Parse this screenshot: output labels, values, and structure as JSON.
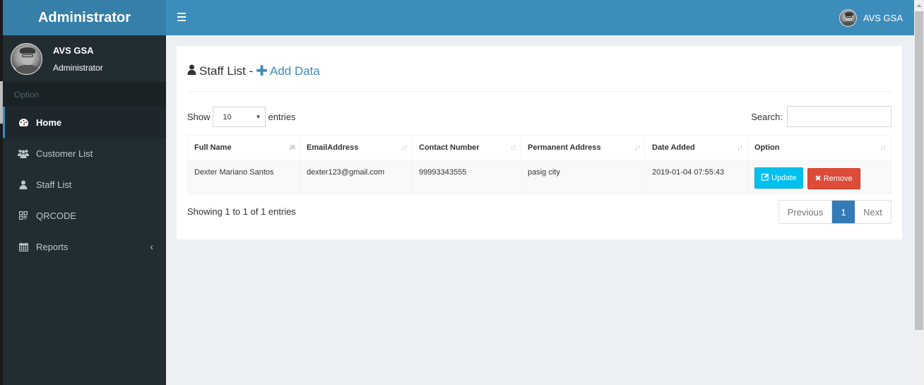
{
  "sidebar": {
    "logo": "Administrator",
    "user": {
      "name": "AVS GSA",
      "role": "Administrator"
    },
    "section_header": "Option",
    "items": [
      {
        "label": "Home",
        "icon": "dashboard-icon",
        "active": true
      },
      {
        "label": "Customer List",
        "icon": "users-icon",
        "active": false
      },
      {
        "label": "Staff List",
        "icon": "user-icon",
        "active": false
      },
      {
        "label": "QRCODE",
        "icon": "qrcode-icon",
        "active": false
      },
      {
        "label": "Reports",
        "icon": "calendar-icon",
        "active": false,
        "has_submenu": true
      }
    ]
  },
  "topbar": {
    "menu_icon": "hamburger-icon",
    "user_name": "AVS GSA"
  },
  "content": {
    "title": "Staff List -",
    "add_label": "Add Data",
    "length": {
      "show_label": "Show",
      "value": "10",
      "entries_label": "entries"
    },
    "search": {
      "label": "Search:",
      "value": "",
      "placeholder": ""
    },
    "table": {
      "columns": [
        "Full Name",
        "EmailAddress",
        "Contact Number",
        "Permanent Address",
        "Date Added",
        "Option"
      ],
      "rows": [
        {
          "full_name": "Dexter Mariano Santos",
          "email": "dexter123@gmail.com",
          "contact": "99993343555",
          "address": "pasig city",
          "date_added": "2019-01-04 07:55:43",
          "update_label": "Update",
          "remove_label": "Remove"
        }
      ]
    },
    "info": "Showing 1 to 1 of 1 entries",
    "pagination": {
      "previous": "Previous",
      "current": "1",
      "next": "Next"
    }
  },
  "colors": {
    "primary": "#3c8dbc",
    "logo_bg": "#367fa9",
    "sidebar_bg": "#222d32",
    "update_btn": "#00c0ef",
    "remove_btn": "#dd4b39",
    "page_active": "#337ab7"
  }
}
